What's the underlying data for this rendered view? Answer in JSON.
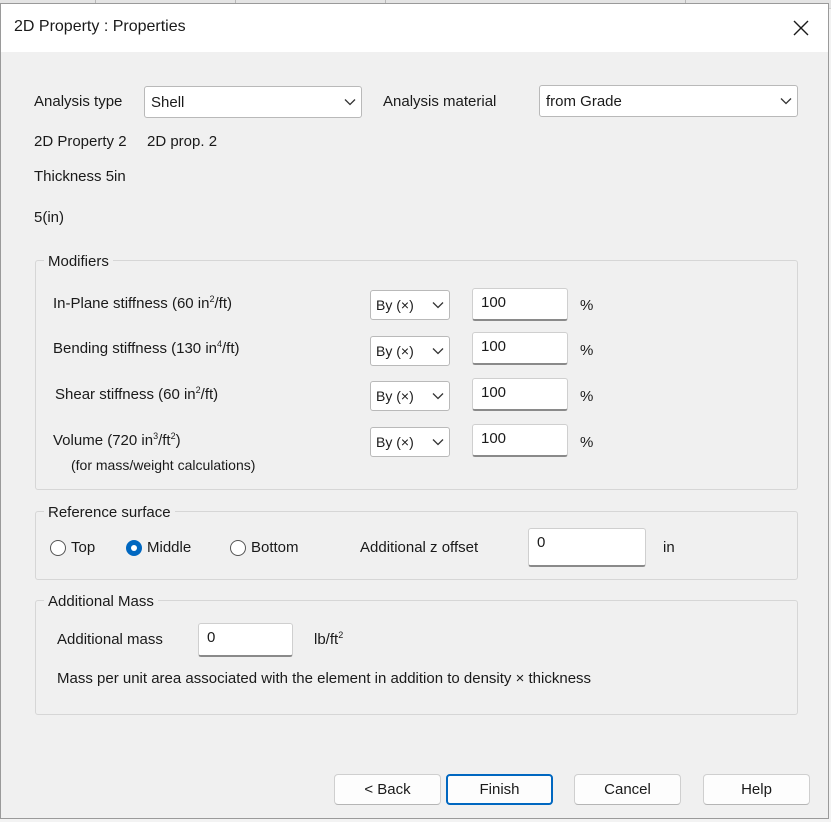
{
  "window": {
    "title": "2D Property : Properties"
  },
  "analysis": {
    "type_label": "Analysis type",
    "type_value": "Shell",
    "material_label": "Analysis material",
    "material_value": "from Grade"
  },
  "info": {
    "property_id": "2D Property 2",
    "property_name": "2D prop. 2",
    "thickness_label": "Thickness 5in",
    "thickness_value": "5(in)"
  },
  "modifiers": {
    "title": "Modifiers",
    "by_label": "By (×)",
    "unit": "%",
    "rows": [
      {
        "pre": "In-Plane stiffness (60 in",
        "sup": "2",
        "post": "/ft)",
        "value": "100"
      },
      {
        "pre": "Bending stiffness (130 in",
        "sup": "4",
        "post": "/ft)",
        "value": "100"
      },
      {
        "pre": "Shear stiffness (60 in",
        "sup": "2",
        "post": "/ft)",
        "value": "100"
      },
      {
        "pre": "Volume (720 in",
        "sup": "3",
        "post": "/ft",
        "sup2": "2",
        "post2": ")",
        "value": "100",
        "sub_note": "(for mass/weight calculations)"
      }
    ]
  },
  "reference": {
    "title": "Reference surface",
    "options": [
      "Top",
      "Middle",
      "Bottom"
    ],
    "selected": "Middle",
    "offset_label": "Additional z offset",
    "offset_value": "0",
    "offset_unit": "in"
  },
  "mass": {
    "title": "Additional Mass",
    "label": "Additional mass",
    "value": "0",
    "unit_pre": "lb/ft",
    "unit_sup": "2",
    "note": "Mass per unit area associated with the element in addition to density × thickness"
  },
  "buttons": {
    "back": "< Back",
    "finish": "Finish",
    "cancel": "Cancel",
    "help": "Help"
  },
  "colors": {
    "accent": "#0067c0",
    "dialog_bg": "#f0f0f0",
    "titlebar_bg": "#ffffff"
  }
}
